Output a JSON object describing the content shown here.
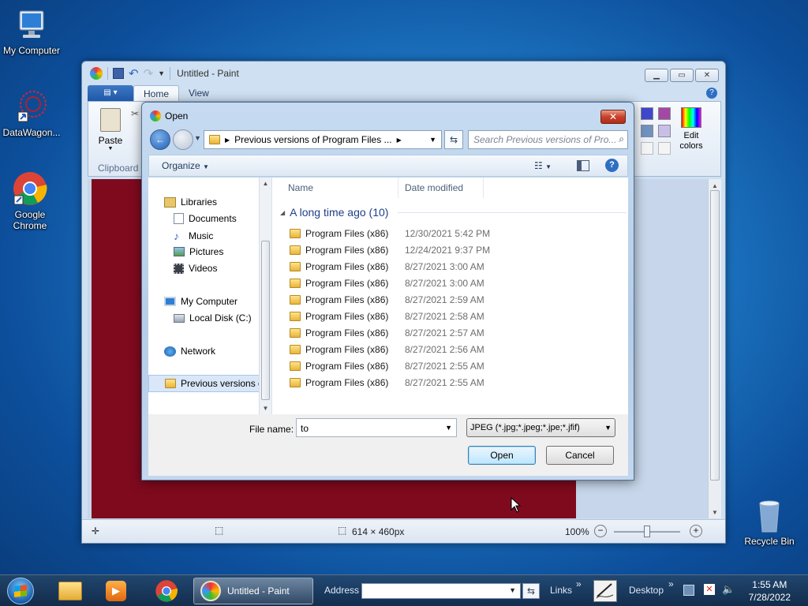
{
  "desktop": {
    "icons": [
      {
        "label": "My Computer"
      },
      {
        "label": "DataWagon..."
      },
      {
        "label": "Google Chrome"
      },
      {
        "label": "Recycle Bin"
      }
    ]
  },
  "paint": {
    "title": "Untitled - Paint",
    "tabs": [
      "Home",
      "View"
    ],
    "ribbon": {
      "paste_label": "Paste",
      "clipboard_label": "Clipboard",
      "edit_colors_label": "Edit colors"
    },
    "status": {
      "dimensions": "614 × 460px",
      "zoom": "100%"
    }
  },
  "dialog": {
    "title": "Open",
    "close_glyph": "✕",
    "address": "Previous versions of Program Files ...",
    "search_placeholder": "Search Previous versions of Pro...",
    "organize_label": "Organize",
    "nav": {
      "libraries": "Libraries",
      "documents": "Documents",
      "music": "Music",
      "pictures": "Pictures",
      "videos": "Videos",
      "my_computer": "My Computer",
      "local_disk": "Local Disk (C:)",
      "network": "Network",
      "previous_versions": "Previous versions c"
    },
    "columns": {
      "name": "Name",
      "date": "Date modified"
    },
    "group_label": "A long time ago (10)",
    "files": [
      {
        "name": "Program Files (x86)",
        "date": "12/30/2021 5:42 PM"
      },
      {
        "name": "Program Files (x86)",
        "date": "12/24/2021 9:37 PM"
      },
      {
        "name": "Program Files (x86)",
        "date": "8/27/2021 3:00 AM"
      },
      {
        "name": "Program Files (x86)",
        "date": "8/27/2021 3:00 AM"
      },
      {
        "name": "Program Files (x86)",
        "date": "8/27/2021 2:59 AM"
      },
      {
        "name": "Program Files (x86)",
        "date": "8/27/2021 2:58 AM"
      },
      {
        "name": "Program Files (x86)",
        "date": "8/27/2021 2:57 AM"
      },
      {
        "name": "Program Files (x86)",
        "date": "8/27/2021 2:56 AM"
      },
      {
        "name": "Program Files (x86)",
        "date": "8/27/2021 2:55 AM"
      },
      {
        "name": "Program Files (x86)",
        "date": "8/27/2021 2:55 AM"
      }
    ],
    "file_name_label": "File name:",
    "file_name_value": "to",
    "file_type": "JPEG (*.jpg;*.jpeg;*.jpe;*.jfif)",
    "open_label": "Open",
    "cancel_label": "Cancel"
  },
  "taskbar": {
    "paint_label": "Untitled - Paint",
    "address_label": "Address",
    "links_label": "Links",
    "desktop_label": "Desktop",
    "time": "1:55 AM",
    "date": "7/28/2022"
  },
  "colors": {
    "canvas": "#7f0a1e",
    "accent": "#1f58a8",
    "dialog_frame": "#b5cde8"
  }
}
